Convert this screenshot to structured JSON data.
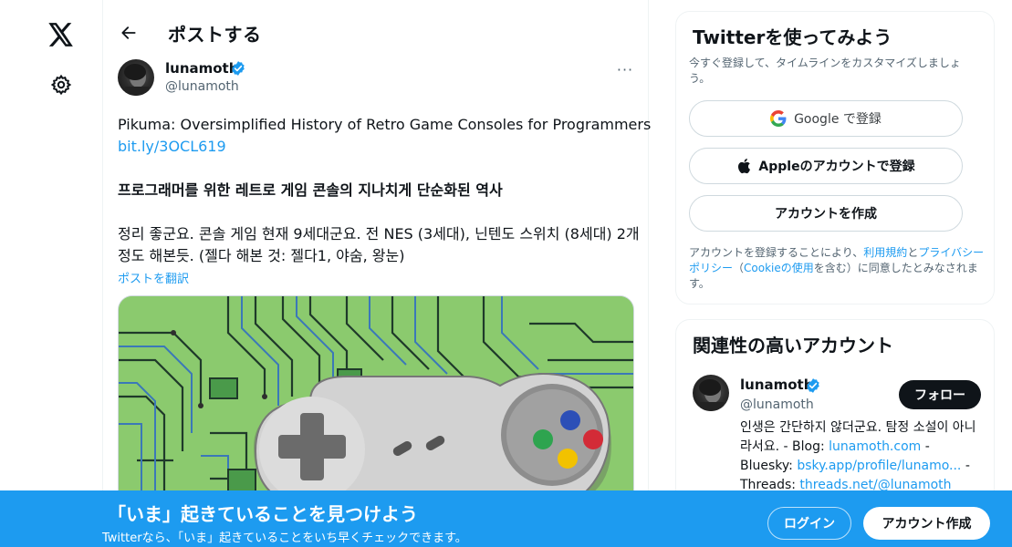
{
  "nav": {
    "logo_icon": "x-logo-icon",
    "settings_icon": "gear-icon"
  },
  "header": {
    "back_icon": "arrow-left-icon",
    "title": "ポストする"
  },
  "tweet": {
    "author_name": "lunamoth",
    "author_handle": "@lunamoth",
    "more_label": "···",
    "line1": "Pikuma: Oversimplified History of Retro Game Consoles for Programmers",
    "link": "bit.ly/3OCL619",
    "bold_line": "프로그래머를 위한 레트로 게임 콘솔의 지나치게 단순화된 역사",
    "body_line1": "정리 좋군요. 콘솔 게임 현재 9세대군요. 전 NES (3세대), 닌텐도 스위치 (8세대) 2개",
    "body_line2": "정도 해본듯. (젤다 해본 것: 젤다1, 야숨, 왕눈)",
    "translate": "ポストを翻訳"
  },
  "signup_card": {
    "title": "Twitterを使ってみよう",
    "subtitle": "今すぐ登録して、タイムラインをカスタマイズしましょう。",
    "google_label": "Google で登録",
    "apple_label": "Appleのアカウントで登録",
    "create_label": "アカウントを作成",
    "terms_prefix": "アカウントを登録することにより、",
    "terms_link1": "利用規約",
    "terms_and": "と",
    "terms_link2": "プライバシーポリシー",
    "terms_paren_open": "（",
    "terms_link3": "Cookieの使用",
    "terms_suffix": "を含む）に同意したとみなされます。"
  },
  "related_card": {
    "title": "関連性の高いアカウント",
    "name": "lunamoth",
    "handle": "@lunamoth",
    "follow_label": "フォロー",
    "bio_line1": "인생은 간단하지 않더군요. 탐정 소설이 아니",
    "bio_line2_prefix": "라서요. - Blog: ",
    "bio_line2_link": "lunamoth.com",
    "bio_line2_suffix": " -",
    "bio_line3_prefix": "Bluesky: ",
    "bio_line3_link": "bsky.app/profile/lunamo...",
    "bio_line3_suffix": " -",
    "bio_line4_prefix": "Threads: ",
    "bio_line4_link": "threads.net/@lunamoth"
  },
  "banner": {
    "title": "「いま」起きていることを見つけよう",
    "subtitle": "Twitterなら、「いま」起きていることをいち早くチェックできます。",
    "login_label": "ログイン",
    "signup_label": "アカウント作成"
  },
  "colors": {
    "accent": "#1d9bf0",
    "text": "#0f1419",
    "muted": "#536471",
    "verified": "#1d9bf0",
    "media_bg": "#8bca6e"
  }
}
